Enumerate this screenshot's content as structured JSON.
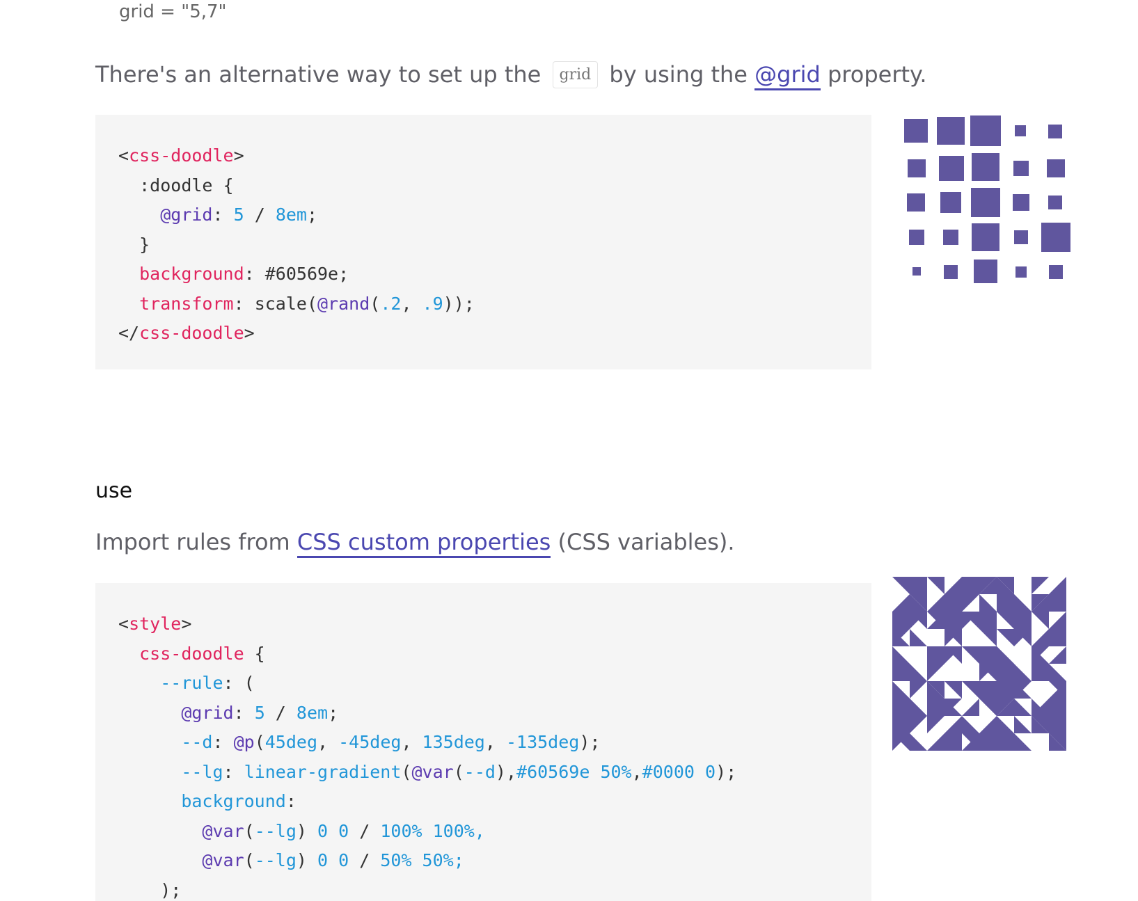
{
  "previous_caption": "grid = \"5,7\"",
  "grid_section": {
    "intro_before": "There's an alternative way to set up the ",
    "inline_code": "grid",
    "intro_middle": " by using the ",
    "link_text": "@grid",
    "intro_after": " property.",
    "code": {
      "open_tag": "css-doodle",
      "selector": ":doodle",
      "grid_at": "@grid",
      "grid_rest": " 5 / 8em",
      "bg_prop": "background",
      "bg_value": "#60569e",
      "transform_prop": "transform",
      "transform_fn": "scale(",
      "rand_at": "@rand",
      "rand_open": "(",
      "rand_a": ".2",
      "rand_sep": ", ",
      "rand_b": ".9",
      "rand_close": "));",
      "close_tag": "css-doodle"
    }
  },
  "use_section": {
    "title": "use",
    "intro_before": "Import rules from ",
    "link_text": "CSS custom properties",
    "intro_after": " (CSS variables).",
    "code": {
      "open_tag": "style",
      "selector": "css-doodle",
      "rule_var": "--rule",
      "grid_at": "@grid",
      "grid_num": "5",
      "grid_unit": "8em",
      "d_var": "--d",
      "p_at": "@p",
      "p_args": [
        "45deg",
        "-45deg",
        "135deg",
        "-135deg"
      ],
      "lg_var": "--lg",
      "lg_fn": "linear-gradient",
      "var_at": "@var",
      "lg_inner_var": "--d",
      "lg_color": "#60569e",
      "lg_stop1": "50%",
      "lg_color2": "#0000",
      "lg_stop2": "0",
      "bg_prop": "background",
      "bg_line1_var": "--lg",
      "bg_line1_pos": "0 0",
      "bg_line1_size": "100% 100%,",
      "bg_line2_var": "--lg",
      "bg_line2_pos": "0 0",
      "bg_line2_size": "50% 50%;",
      "close": ");"
    }
  },
  "colors": {
    "doodle": "#60569e",
    "link": "#4a47b0",
    "code_bg": "#f5f5f5"
  }
}
